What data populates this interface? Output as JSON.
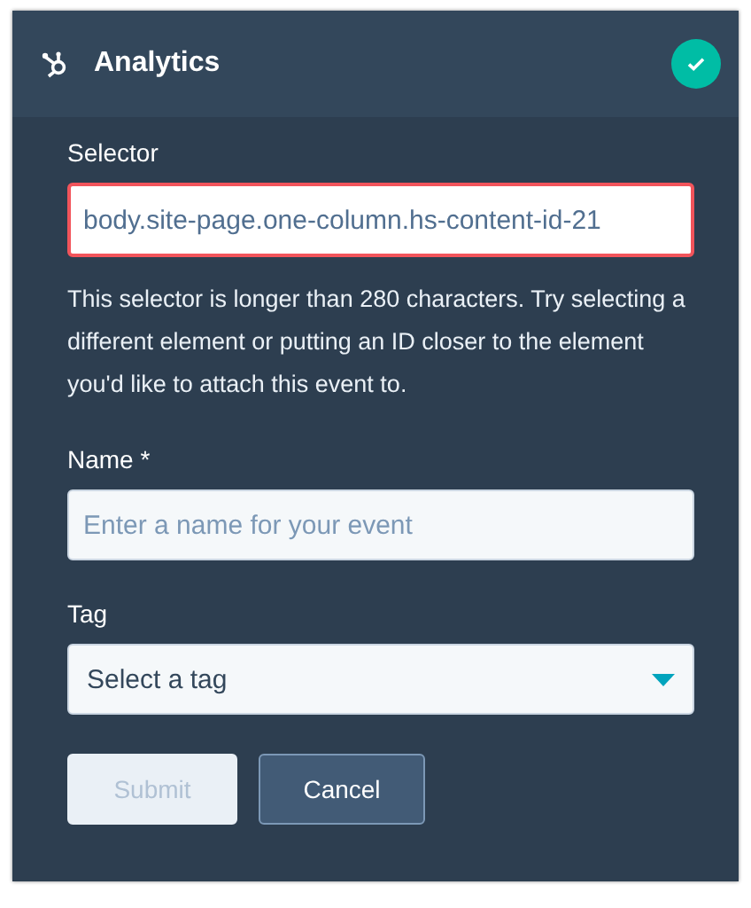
{
  "header": {
    "title": "Analytics",
    "status_ok": true
  },
  "fields": [
    {
      "kind": "text",
      "label": "Selector",
      "value": "body.site-page.one-column.hs-content-id-21",
      "error": true,
      "help": "This selector is longer than 280 characters. Try selecting a different element or putting an ID closer to the element you'd like to attach this event to."
    },
    {
      "kind": "text",
      "label": "Name *",
      "placeholder": "Enter a name for your event",
      "error": false
    },
    {
      "kind": "select",
      "label": "Tag",
      "value": "Select a tag",
      "error": false
    }
  ],
  "buttons": [
    {
      "label": "Submit",
      "kind": "primary",
      "disabled": true
    },
    {
      "label": "Cancel",
      "kind": "secondary",
      "disabled": false
    }
  ]
}
